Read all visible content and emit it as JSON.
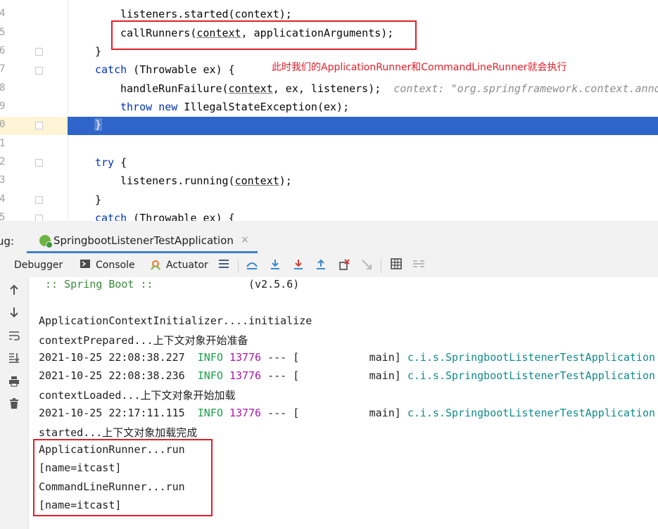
{
  "editor": {
    "line_numbers": [
      "4",
      "5",
      "6",
      "7",
      "8",
      "9",
      "0",
      "1",
      "2",
      "3",
      "4",
      "5"
    ],
    "lines": {
      "started": "listeners.started(context);",
      "call_runners_fn": "callRunners(",
      "call_runners_ctx": "context",
      "call_runners_rest": ", applicationArguments);",
      "close_brace_1": "}",
      "catch_kw_1": "catch",
      "catch_rest_1": " (Throwable ex) {",
      "handle_fn": "handleRunFailure(",
      "handle_ctx": "context",
      "handle_rest": ", ex, listeners);",
      "handle_hint": "context: \"org.springframework.context.anno",
      "throw_kw": "throw",
      "new_kw": "new",
      "throw_rest": " IllegalStateException(ex);",
      "highlighted_brace": "}",
      "try_kw": "try",
      "try_rest": " {",
      "running_fn": "listeners.running(",
      "running_ctx": "context",
      "running_rest": ");",
      "close_brace_2": "}",
      "catch_kw_2": "catch",
      "catch_rest_2": " (Throwable ex) {"
    },
    "annotation": "此时我们的ApplicationRunner和CommandLineRunner就会执行"
  },
  "debug": {
    "label": "ug:",
    "run_tab": "SpringbootListenerTestApplication",
    "close": "×"
  },
  "toolbar": {
    "debugger": "Debugger",
    "console": "Console",
    "actuator": "Actuator"
  },
  "console": {
    "boot_prefix": " :: Spring Boot :: ",
    "boot_version": "(v2.5.6)",
    "initializer": "ApplicationContextInitializer....initialize",
    "prepared": "contextPrepared...上下文对象开始准备",
    "log_lines": [
      {
        "ts": "2021-10-25 22:08:38.227",
        "level": "INFO",
        "pid": "13776",
        "sep": "--- [",
        "thread": "main]",
        "cls": "c.i.s.SpringbootListenerTestApplication"
      },
      {
        "ts": "2021-10-25 22:08:38.236",
        "level": "INFO",
        "pid": "13776",
        "sep": "--- [",
        "thread": "main]",
        "cls": "c.i.s.SpringbootListenerTestApplication"
      },
      {
        "ts": "2021-10-25 22:17:11.115",
        "level": "INFO",
        "pid": "13776",
        "sep": "--- [",
        "thread": "main]",
        "cls": "c.i.s.SpringbootListenerTestApplication"
      }
    ],
    "loaded": "contextLoaded...上下文对象开始加载",
    "started": "started...上下文对象加载完成",
    "app_runner": "ApplicationRunner...run",
    "name1": "[name=itcast]",
    "cmd_runner": "CommandLineRunner...run",
    "name2": "[name=itcast]"
  },
  "colors": {
    "keyword": "#0033b3",
    "annotation_red": "#e0202a",
    "selection_blue": "#2f65ca",
    "info_green": "#17a34a",
    "pid_purple": "#a818a8",
    "class_teal": "#128a8a"
  }
}
